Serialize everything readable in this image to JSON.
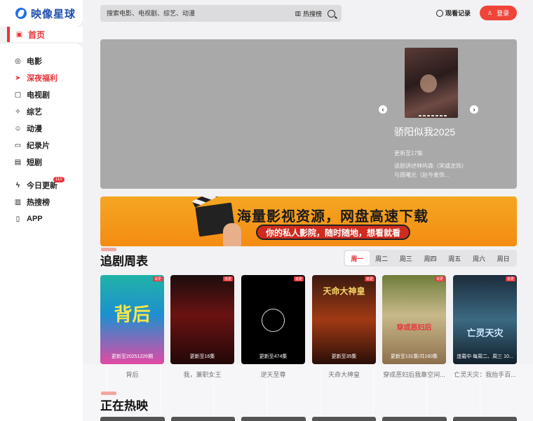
{
  "brand": {
    "name": "映像星球",
    "accent": "#e8343a",
    "logo_color": "#1f4fb0"
  },
  "nav": {
    "home": "首页",
    "items": [
      {
        "label": "电影",
        "icon": "film-reel-icon"
      },
      {
        "label": "深夜福利",
        "icon": "paper-plane-icon",
        "active": true
      },
      {
        "label": "电视剧",
        "icon": "tv-icon"
      },
      {
        "label": "综艺",
        "icon": "sparkle-icon"
      },
      {
        "label": "动漫",
        "icon": "cartoon-face-icon"
      },
      {
        "label": "纪录片",
        "icon": "camera-icon"
      },
      {
        "label": "短剧",
        "icon": "clapperboard-icon"
      }
    ],
    "items2": [
      {
        "label": "今日更新",
        "icon": "lightning-icon",
        "badge": "110"
      },
      {
        "label": "热搜榜",
        "icon": "chart-icon"
      },
      {
        "label": "APP",
        "icon": "phone-icon"
      }
    ]
  },
  "search": {
    "placeholder": "搜索电影、电视剧、综艺、动漫",
    "hot_label": "热搜榜"
  },
  "header": {
    "history": "观看记录",
    "login": "登录"
  },
  "hero": {
    "title": "骄阳似我2025",
    "update": "更新至17集",
    "desc": "该剧讲述林屿森（宋威龙饰）与聂曦光（赵今麦饰..."
  },
  "banner": {
    "title": "海量影视资源，网盘高速下载",
    "subtitle": "你的私人影院，随时随地，想看就看"
  },
  "schedule": {
    "title": "追剧周表",
    "days": [
      "周一",
      "周二",
      "周三",
      "周四",
      "周五",
      "周六",
      "周日"
    ],
    "active_day": "周一",
    "cards": [
      {
        "title": "背后",
        "update": "更新至20251226期",
        "tag": "追更",
        "art": "背后"
      },
      {
        "title": "我，兼职女王",
        "update": "更新至16集",
        "tag": "追更",
        "art": ""
      },
      {
        "title": "逆天至尊",
        "update": "更新至474集",
        "tag": "追更",
        "art": ""
      },
      {
        "title": "天命大神皇",
        "update": "更新至35集",
        "tag": "追更",
        "art": "天命大神皇"
      },
      {
        "title": "穿成恶妇后我靠空间...",
        "update": "更新至131集/共160集",
        "tag": "追更",
        "art": "穿成恶妇后"
      },
      {
        "title": "亡灵天灾：我抬手百...",
        "update": "连载中 每周二、周三 10...",
        "tag": "追更",
        "art": "亡灵天灾"
      }
    ]
  },
  "now_showing": {
    "title": "正在热映"
  }
}
